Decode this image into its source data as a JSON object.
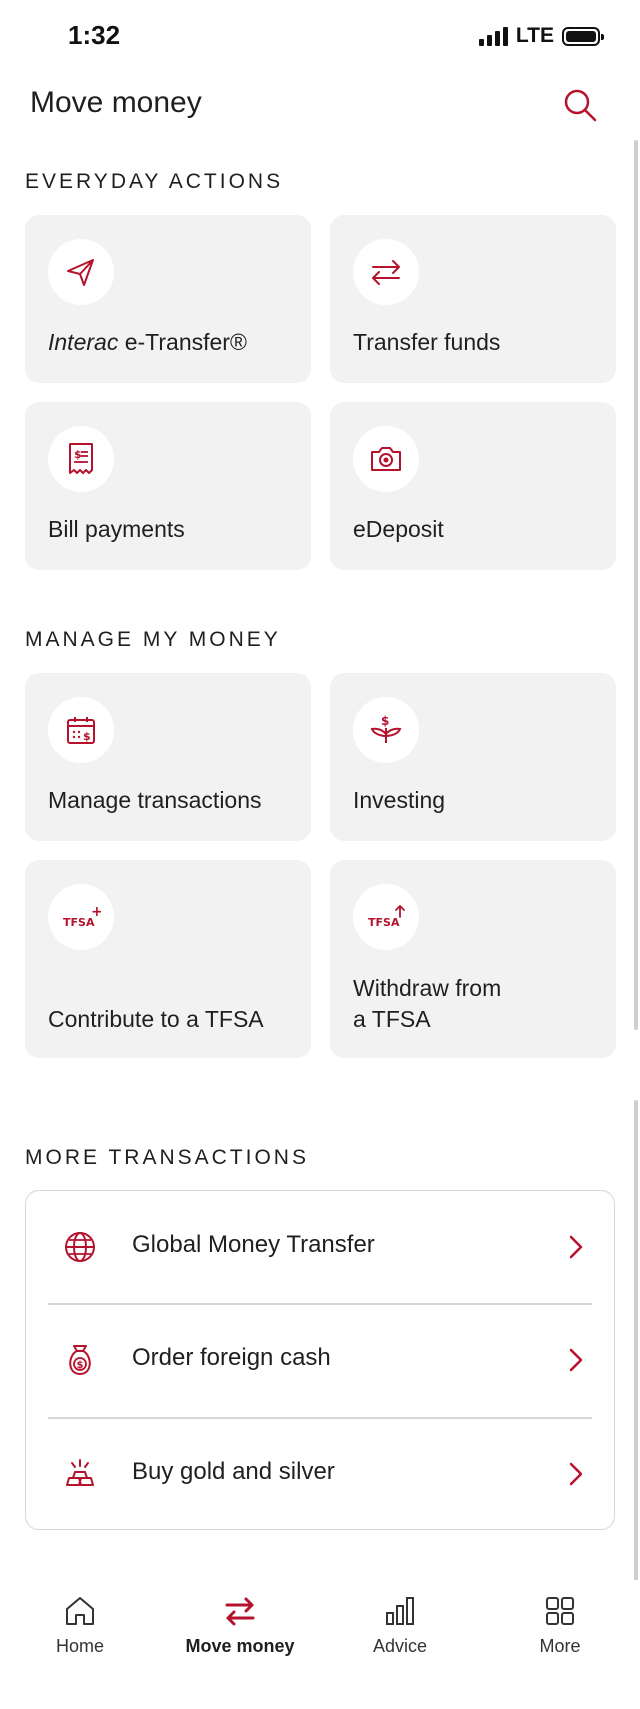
{
  "status": {
    "time": "1:32",
    "network": "LTE"
  },
  "header": {
    "title": "Move money"
  },
  "colors": {
    "accent": "#b5122e",
    "card_bg": "#f2f2f2",
    "divider": "#d6d6d6"
  },
  "sections": {
    "everyday": "EVERYDAY ACTIONS",
    "manage": "MANAGE MY MONEY",
    "more": "MORE TRANSACTIONS"
  },
  "everyday_cards": [
    {
      "label_italic": "Interac",
      "label_rest": " e-Transfer®",
      "icon": "send-icon"
    },
    {
      "label": "Transfer funds",
      "icon": "swap-arrows-icon"
    },
    {
      "label": "Bill payments",
      "icon": "bill-receipt-icon"
    },
    {
      "label": "eDeposit",
      "icon": "camera-icon"
    }
  ],
  "manage_cards": [
    {
      "label": "Manage transactions",
      "icon": "calendar-dollar-icon"
    },
    {
      "label": "Investing",
      "icon": "plant-dollar-icon"
    },
    {
      "label": "Contribute to a TFSA",
      "icon": "tfsa-plus-icon",
      "icon_text": "TFSA",
      "icon_mark": "+"
    },
    {
      "label_line1": "Withdraw from",
      "label_line2": "a TFSA",
      "icon": "tfsa-arrow-icon",
      "icon_text": "TFSA"
    }
  ],
  "more_list": [
    {
      "label": "Global Money Transfer",
      "icon": "globe-icon"
    },
    {
      "label": "Order foreign cash",
      "icon": "money-bag-icon"
    },
    {
      "label": "Buy gold and silver",
      "icon": "gold-bars-icon"
    }
  ],
  "tabs": [
    {
      "label": "Home",
      "icon": "home-icon"
    },
    {
      "label": "Move money",
      "icon": "transfer-arrows-icon",
      "active": true
    },
    {
      "label": "Advice",
      "icon": "bar-chart-icon"
    },
    {
      "label": "More",
      "icon": "grid-icon"
    }
  ]
}
